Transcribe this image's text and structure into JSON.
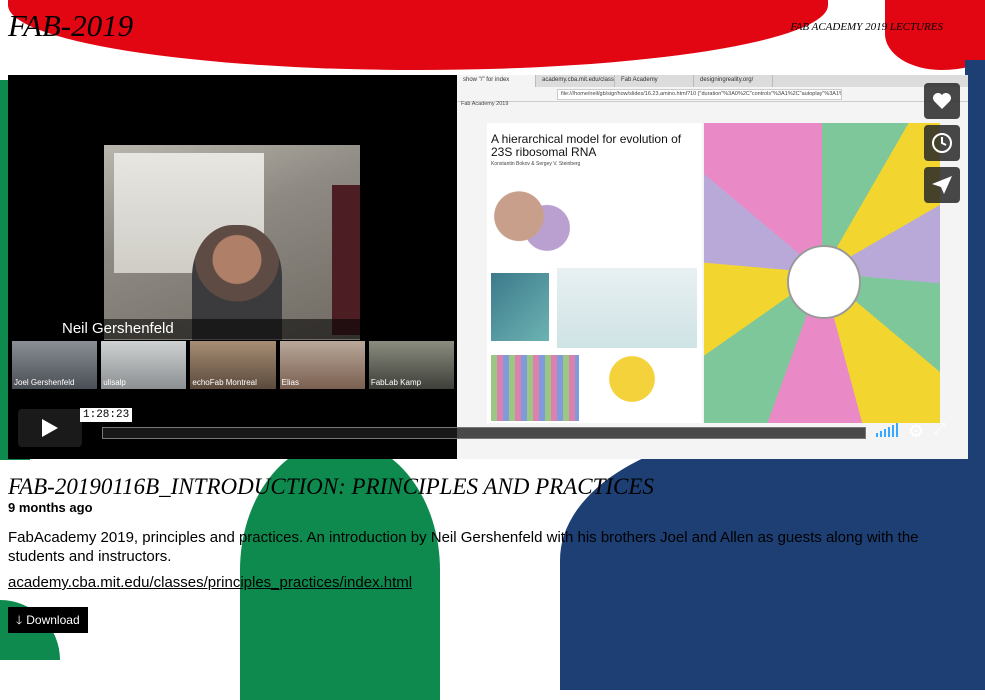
{
  "site": {
    "title": "FAB-2019",
    "nav_label": "FAB ACADEMY 2019 LECTURES"
  },
  "player": {
    "speaker_name": "Neil Gershenfeld",
    "participants": [
      "Joel Gershenfeld",
      "ulisalp",
      "echoFab Montreal",
      "Elias",
      "FabLab Kamp"
    ],
    "screen": {
      "tabs": [
        "show \"/\" for index",
        "academy.cba.mit.edu/classes/p",
        "Fab Academy",
        "designingreality.org/"
      ],
      "url": "file:///home/neil/gb/sigr/how/slides/16.23.amino.html?10 {\"duration\"%3A0%2C\"controls\"%3A1%2C\"autoplay\"%3A1%2C\"",
      "bookmark": "Fab Academy 2019",
      "slide_title": "A hierarchical model for evolution of 23S ribosomal RNA",
      "slide_authors": "Konstantin Bokov  &  Sergey V. Steinberg"
    },
    "time_tooltip": "1:28:23",
    "icons": {
      "like": "heart-icon",
      "watch_later": "clock-icon",
      "share": "paper-plane-icon",
      "play": "play-icon",
      "volume": "volume-icon",
      "settings": "gear-icon",
      "fullscreen": "fullscreen-icon"
    }
  },
  "video": {
    "title": "FAB-20190116B_INTRODUCTION: PRINCIPLES AND PRACTICES",
    "date": "9 months ago",
    "description": "FabAcademy 2019, principles and practices. An introduction by Neil Gershenfeld with his brothers Joel and Allen as guests along with the students and instructors.",
    "link": "academy.cba.mit.edu/classes/principles_practices/index.html",
    "download_label": "Download"
  },
  "colors": {
    "red": "#e20613",
    "green": "#0f8a4f",
    "blue": "#1d3f74",
    "accent": "#39a9ff"
  }
}
